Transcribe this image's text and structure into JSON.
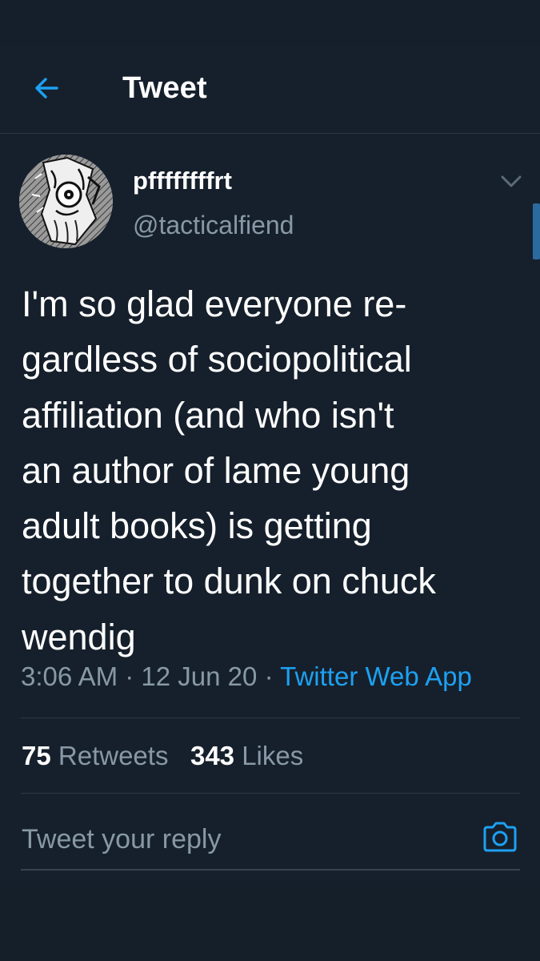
{
  "header": {
    "title": "Tweet",
    "back_icon": "arrow-left-icon"
  },
  "tweet": {
    "author": {
      "display_name": "pffffffffrt",
      "handle": "@tacticalfiend"
    },
    "text_lines": [
      "I'm so glad everyone re-",
      "gardless of sociopolitical",
      "affiliation (and who isn't",
      "an author of lame young",
      "adult books) is getting",
      "together to dunk on chuck",
      "wendig"
    ],
    "time": "3:06 AM",
    "date": "12 Jun 20",
    "separator": "·",
    "source": "Twitter Web App",
    "retweets_count": "75",
    "retweets_label": "Retweets",
    "likes_count": "343",
    "likes_label": "Likes"
  },
  "reply": {
    "placeholder": "Tweet your reply",
    "camera_icon": "camera-icon"
  },
  "colors": {
    "background": "#16202c",
    "accent": "#1da1f2",
    "secondary_text": "#8899a6",
    "divider": "#2c3845"
  }
}
